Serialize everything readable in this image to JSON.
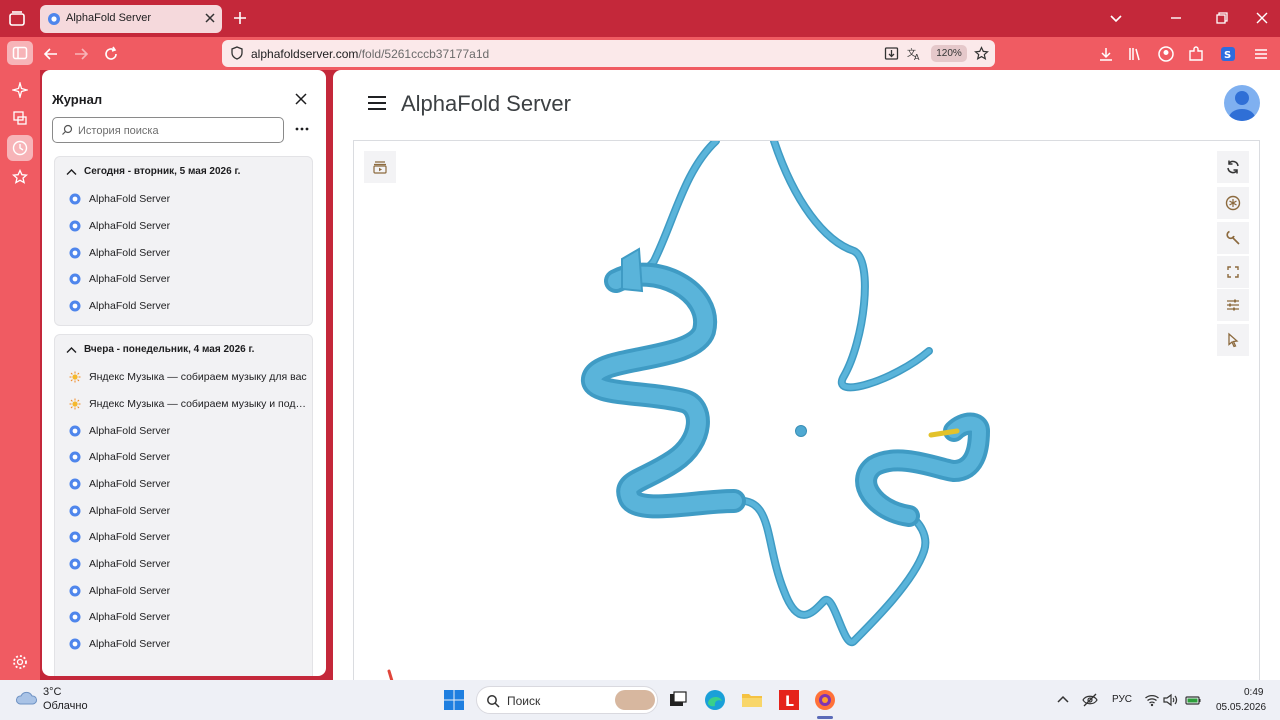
{
  "browser": {
    "tab_title": "AlphaFold Server",
    "url_domain": "alphafoldserver.com",
    "url_path": "/fold/5261cccb37177a1d",
    "zoom": "120%"
  },
  "history": {
    "title": "Журнал",
    "search_placeholder": "История поиска",
    "groups": [
      {
        "label": "Сегодня - вторник, 5 мая 2026 г.",
        "items": [
          {
            "text": "AlphaFold Server",
            "icon": "alphafold-favicon"
          },
          {
            "text": "AlphaFold Server",
            "icon": "alphafold-favicon"
          },
          {
            "text": "AlphaFold Server",
            "icon": "alphafold-favicon"
          },
          {
            "text": "AlphaFold Server",
            "icon": "alphafold-favicon"
          },
          {
            "text": "AlphaFold Server",
            "icon": "alphafold-favicon"
          }
        ]
      },
      {
        "label": "Вчера - понедельник, 4 мая 2026 г.",
        "items": [
          {
            "text": "Яндекс Музыка — собираем музыку для вас",
            "icon": "yandex-music-favicon"
          },
          {
            "text": "Яндекс Музыка — собираем музыку и подка...",
            "icon": "yandex-music-favicon"
          },
          {
            "text": "AlphaFold Server",
            "icon": "alphafold-favicon"
          },
          {
            "text": "AlphaFold Server",
            "icon": "alphafold-favicon"
          },
          {
            "text": "AlphaFold Server",
            "icon": "alphafold-favicon"
          },
          {
            "text": "AlphaFold Server",
            "icon": "alphafold-favicon"
          },
          {
            "text": "AlphaFold Server",
            "icon": "alphafold-favicon"
          },
          {
            "text": "AlphaFold Server",
            "icon": "alphafold-favicon"
          },
          {
            "text": "AlphaFold Server",
            "icon": "alphafold-favicon"
          },
          {
            "text": "AlphaFold Server",
            "icon": "alphafold-favicon"
          },
          {
            "text": "AlphaFold Server",
            "icon": "alphafold-favicon"
          }
        ]
      }
    ]
  },
  "page": {
    "app_title": "AlphaFold Server",
    "viewer_tools": [
      "reset-view-icon",
      "color-scheme-icon",
      "wrench-icon",
      "fullscreen-icon",
      "settings-sliders-icon",
      "select-cursor-icon"
    ]
  },
  "taskbar": {
    "temperature": "3°C",
    "weather": "Облачно",
    "search_placeholder": "Поиск",
    "language": "РУС",
    "time": "0:49",
    "date": "05.05.2026"
  },
  "colors": {
    "browser_accent": "#c4283a",
    "browser_toolbar": "#f05b62",
    "ribbon": "#5ab4da",
    "ligand": "#e3c22a"
  }
}
